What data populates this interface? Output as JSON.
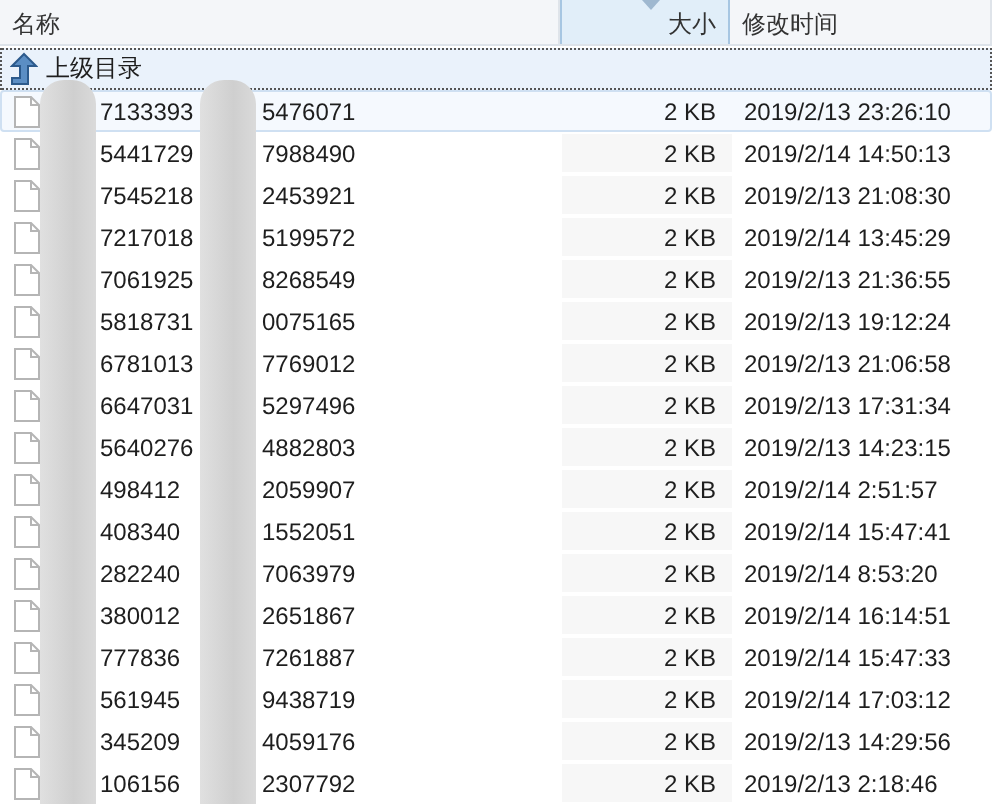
{
  "columns": [
    {
      "label": "名称",
      "sorted": false
    },
    {
      "label": "大小",
      "sorted": true
    },
    {
      "label": "修改时间",
      "sorted": false
    }
  ],
  "parent_row": {
    "label": "上级目录",
    "focused": true
  },
  "files": [
    {
      "name_start": "7133393",
      "name_end": "5476071",
      "size": "2 KB",
      "modified": "2019/2/13 23:26:10",
      "hovered": true
    },
    {
      "name_start": "5441729",
      "name_end": "7988490",
      "size": "2 KB",
      "modified": "2019/2/14 14:50:13",
      "hovered": false
    },
    {
      "name_start": "7545218",
      "name_end": "2453921",
      "size": "2 KB",
      "modified": "2019/2/13 21:08:30",
      "hovered": false
    },
    {
      "name_start": "7217018",
      "name_end": "5199572",
      "size": "2 KB",
      "modified": "2019/2/14 13:45:29",
      "hovered": false
    },
    {
      "name_start": "7061925",
      "name_end": "8268549",
      "size": "2 KB",
      "modified": "2019/2/13 21:36:55",
      "hovered": false
    },
    {
      "name_start": "5818731",
      "name_end": "0075165",
      "size": "2 KB",
      "modified": "2019/2/13 19:12:24",
      "hovered": false
    },
    {
      "name_start": "6781013",
      "name_end": "7769012",
      "size": "2 KB",
      "modified": "2019/2/13 21:06:58",
      "hovered": false
    },
    {
      "name_start": "6647031",
      "name_end": "5297496",
      "size": "2 KB",
      "modified": "2019/2/13 17:31:34",
      "hovered": false
    },
    {
      "name_start": "5640276",
      "name_end": "4882803",
      "size": "2 KB",
      "modified": "2019/2/13 14:23:15",
      "hovered": false
    },
    {
      "name_start": "498412",
      "name_end": "2059907",
      "size": "2 KB",
      "modified": "2019/2/14 2:51:57",
      "hovered": false
    },
    {
      "name_start": "408340",
      "name_end": "1552051",
      "size": "2 KB",
      "modified": "2019/2/14 15:47:41",
      "hovered": false
    },
    {
      "name_start": "282240",
      "name_end": "7063979",
      "size": "2 KB",
      "modified": "2019/2/14 8:53:20",
      "hovered": false
    },
    {
      "name_start": "380012",
      "name_end": "2651867",
      "size": "2 KB",
      "modified": "2019/2/14 16:14:51",
      "hovered": false
    },
    {
      "name_start": "777836",
      "name_end": "7261887",
      "size": "2 KB",
      "modified": "2019/2/14 15:47:33",
      "hovered": false
    },
    {
      "name_start": "561945",
      "name_end": "9438719",
      "size": "2 KB",
      "modified": "2019/2/14 17:03:12",
      "hovered": false
    },
    {
      "name_start": "345209",
      "name_end": "4059176",
      "size": "2 KB",
      "modified": "2019/2/13 14:29:56",
      "hovered": false
    },
    {
      "name_start": "106156",
      "name_end": "2307792",
      "size": "2 KB",
      "modified": "2019/2/13 2:18:46",
      "hovered": false
    }
  ]
}
